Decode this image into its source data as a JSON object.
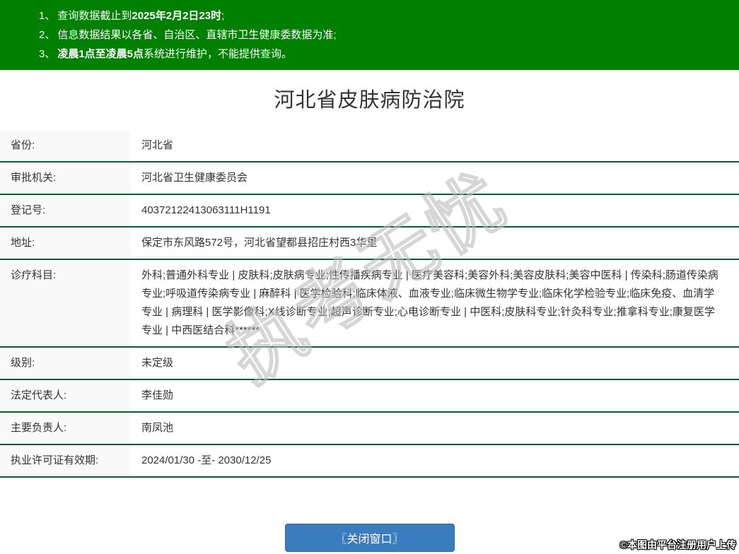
{
  "colors": {
    "banner_green": "#008000",
    "table_border_green": "#075c3a",
    "label_cell_bg": "#f9f9f9",
    "button_blue": "#3a7dbf",
    "text": "#333333"
  },
  "notice": {
    "items": [
      {
        "num": "1、",
        "pre": "查询数据截止到",
        "bold": "2025年2月2日23时",
        "post": ";"
      },
      {
        "num": "2、",
        "pre": "信息数据结果以各省、自治区、直辖市卫生健康委数据为准;",
        "bold": "",
        "post": ""
      },
      {
        "num": "3、",
        "pre": "",
        "bold": "凌晨1点至凌晨5点",
        "post": "系统进行维护，不能提供查询。"
      }
    ]
  },
  "page": {
    "title": "河北省皮肤病防治院"
  },
  "table": {
    "rows": [
      {
        "label": "省份:",
        "value": "河北省"
      },
      {
        "label": "审批机关:",
        "value": "河北省卫生健康委员会"
      },
      {
        "label": "登记号:",
        "value": "40372122413063111H1191"
      },
      {
        "label": "地址:",
        "value": "保定市东风路572号，河北省望都县招庄村西3华里"
      },
      {
        "label": "诊疗科目:",
        "value": "外科;普通外科专业 | 皮肤科;皮肤病专业;性传播疾病专业 | 医疗美容科;美容外科;美容皮肤科;美容中医科 | 传染科;肠道传染病专业;呼吸道传染病专业 | 麻醉科 | 医学检验科;临床体液、血液专业;临床微生物学专业;临床化学检验专业;临床免疫、血清学专业 | 病理科 | 医学影像科;X线诊断专业;超声诊断专业;心电诊断专业 | 中医科;皮肤科专业;针灸科专业;推拿科专业;康复医学专业 | 中西医结合科******"
      },
      {
        "label": "级别:",
        "value": "未定级"
      },
      {
        "label": "法定代表人:",
        "value": "李佳勋"
      },
      {
        "label": "主要负责人:",
        "value": "南凤池"
      },
      {
        "label": "执业许可证有效期:",
        "value": "2024/01/30 -至- 2030/12/25"
      }
    ]
  },
  "watermark": {
    "text": "执考无忧"
  },
  "close_button": {
    "label": "〖关闭窗口〗"
  },
  "footer": {
    "credit": "©本图由平台注册用户上传"
  }
}
